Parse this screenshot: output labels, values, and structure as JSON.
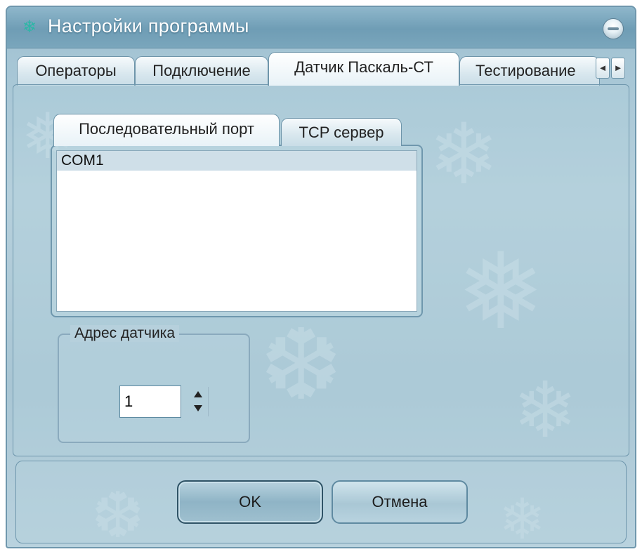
{
  "window": {
    "title": "Настройки программы",
    "icons": {
      "app": "snowflake-icon",
      "close": "minimize-orb-icon"
    }
  },
  "main_tabs": [
    {
      "label": "Операторы",
      "active": false
    },
    {
      "label": "Подключение",
      "active": false
    },
    {
      "label": "Датчик Паскаль-СТ",
      "active": true
    },
    {
      "label": "Тестирование",
      "active": false
    }
  ],
  "tab_scroll": {
    "left_icon": "◄",
    "right_icon": "►"
  },
  "sub_tabs": [
    {
      "label": "Последовательный порт",
      "active": true
    },
    {
      "label": "TCP сервер",
      "active": false
    }
  ],
  "port_list": {
    "items": [
      "COM1"
    ],
    "selected": "COM1"
  },
  "sensor_address": {
    "label": "Адрес датчика",
    "value": "1"
  },
  "buttons": {
    "ok": "OK",
    "cancel": "Отмена"
  },
  "colors": {
    "accent": "#6f97ad",
    "title_text": "#ffffff",
    "app_icon": "#2bb7a6"
  }
}
